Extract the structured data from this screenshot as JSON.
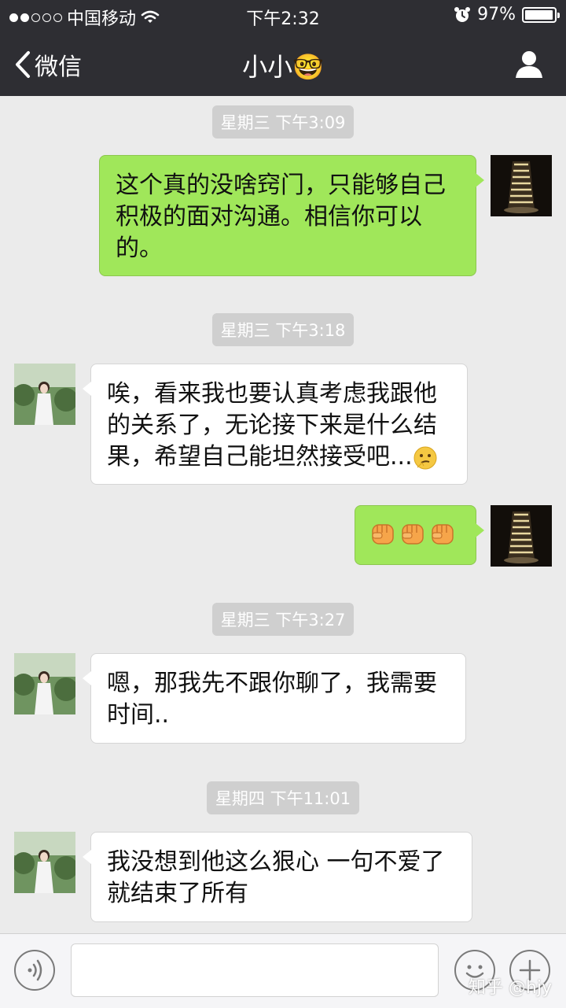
{
  "status": {
    "carrier": "中国移动",
    "time": "下午2:32",
    "battery": "97%",
    "battery_level": 0.97,
    "signal_bars": 2
  },
  "nav": {
    "back_label": "微信",
    "title": "小小🤓",
    "profile_icon": "person-icon"
  },
  "messages": [
    {
      "type": "time",
      "text": "星期三 下午3:09"
    },
    {
      "type": "msg",
      "from": "me",
      "text": "这个真的没啥窍门，只能够自己积极的面对沟通。相信你可以的。"
    },
    {
      "type": "time",
      "text": "星期三 下午3:18"
    },
    {
      "type": "msg",
      "from": "friend",
      "text": "唉，看来我也要认真考虑我跟他的关系了，无论接下来是什么结果，希望自己能坦然接受吧...",
      "emoji": "thinking-face-emoji"
    },
    {
      "type": "msg",
      "from": "me",
      "text": "",
      "emoji": "fist-emoji x3"
    },
    {
      "type": "time",
      "text": "星期三 下午3:27"
    },
    {
      "type": "msg",
      "from": "friend",
      "text": "嗯，那我先不跟你聊了，我需要时间.."
    },
    {
      "type": "time",
      "text": "星期四 下午11:01"
    },
    {
      "type": "msg",
      "from": "friend",
      "text": "我没想到他这么狠心 一句不爱了就结束了所有"
    }
  ],
  "watermark": "知乎 @hjy",
  "colors": {
    "nav_bg": "#2e2e33",
    "chat_bg": "#ebebeb",
    "my_bubble": "#a0e75a",
    "friend_bubble": "#ffffff",
    "time_pill": "#cfcfcf"
  }
}
